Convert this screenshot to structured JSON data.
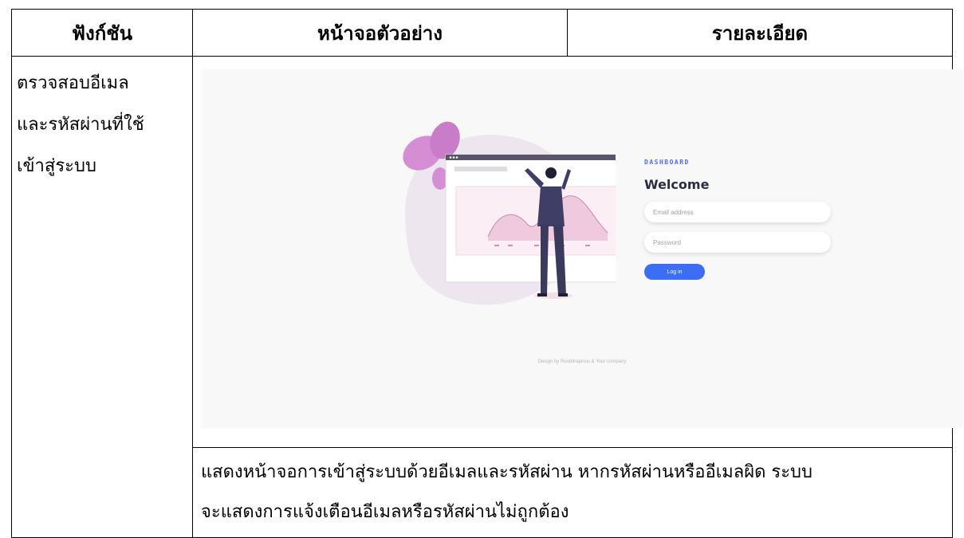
{
  "table": {
    "headers": [
      "ฟังก์ชัน",
      "หน้าจอตัวอย่าง",
      "รายละเอียด"
    ],
    "function_lines": [
      "ตรวจสอบอีเมล",
      "และรหัสผ่านที่ใช้",
      "เข้าสู่ระบบ"
    ],
    "description_lines": [
      "แสดงหน้าจอการเข้าสู่ระบบด้วยอีเมลและรหัสผ่าน หากรหัสผ่านหรืออีเมลผิด ระบบ",
      "จะแสดงการแจ้งเตือนอีเมลหรือรหัสผ่านไม่ถูกต้อง"
    ]
  },
  "preview": {
    "brand": "DASHBOARD",
    "welcome": "Welcome",
    "email_placeholder": "Email address",
    "password_placeholder": "Password",
    "login_label": "Log in",
    "credit": "Design by Roobitrapinus & Your company",
    "accent_color": "#3b6ef5"
  }
}
